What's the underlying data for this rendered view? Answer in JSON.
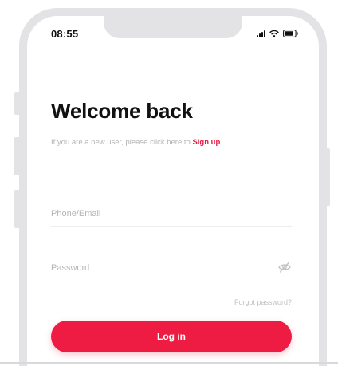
{
  "status_bar": {
    "time": "08:55",
    "icons": [
      "signal-icon",
      "wifi-icon",
      "battery-icon"
    ]
  },
  "login": {
    "title": "Welcome back",
    "subtitle_text": "If you are a new user, please click here to ",
    "signup_label": "Sign up",
    "phone_placeholder": "Phone/Email",
    "phone_value": "",
    "password_placeholder": "Password",
    "password_value": "",
    "password_toggle_icon": "eye-off-icon",
    "forgot_label": "Forgot password?",
    "login_label": "Log in"
  },
  "colors": {
    "accent": "#ee1c43",
    "link": "#e6193f",
    "frame": "#e3e3e5",
    "muted_text": "#b4b4b8"
  }
}
